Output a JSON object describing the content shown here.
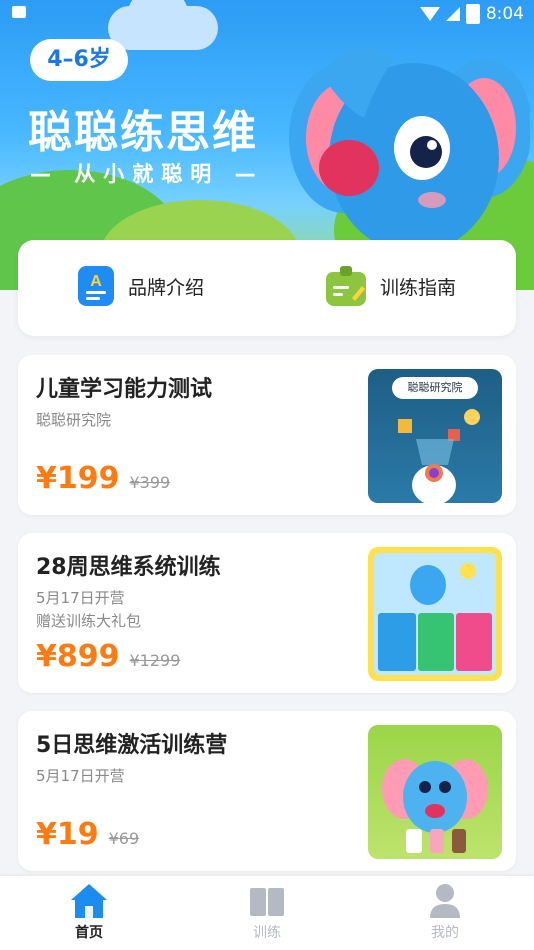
{
  "status_bar": {
    "time": "8:04"
  },
  "hero": {
    "age_badge": "4–6岁",
    "title": "聪聪练思维",
    "subtitle": "— 从小就聪明 —"
  },
  "quick_links": [
    {
      "label": "品牌介绍",
      "icon": "document-icon"
    },
    {
      "label": "训练指南",
      "icon": "clipboard-icon"
    }
  ],
  "courses": [
    {
      "title": "儿童学习能力测试",
      "lines": [
        "聪聪研究院"
      ],
      "price": "¥199",
      "original_price": "¥399",
      "thumb_label": "聪聪研究院"
    },
    {
      "title": "28周思维系统训练",
      "lines": [
        "5月17日开营",
        "赠送训练大礼包"
      ],
      "price": "¥899",
      "original_price": "¥1299"
    },
    {
      "title": "5日思维激活训练营",
      "lines": [
        "5月17日开营"
      ],
      "price": "¥19",
      "original_price": "¥69"
    }
  ],
  "tabs": [
    {
      "label": "首页",
      "active": true
    },
    {
      "label": "训练",
      "active": false
    },
    {
      "label": "我的",
      "active": false
    }
  ],
  "colors": {
    "accent": "#1b8df1",
    "price": "#ff7a11",
    "inactive": "#b5b9c3"
  }
}
